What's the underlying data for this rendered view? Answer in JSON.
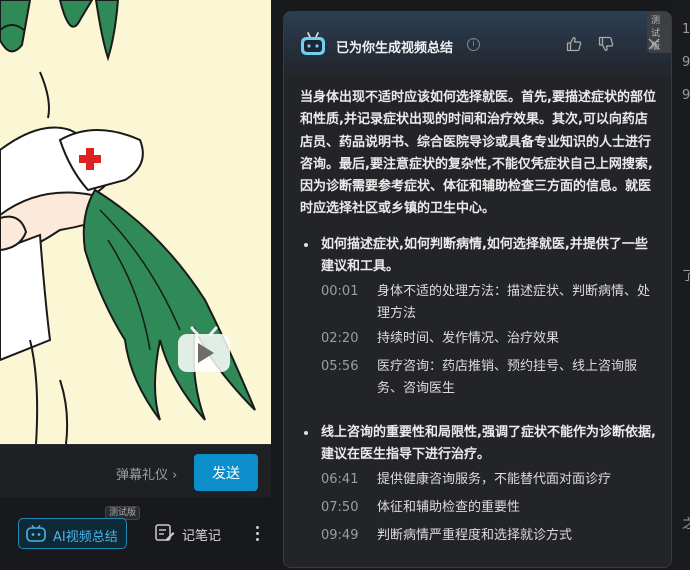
{
  "player": {
    "danmaku_placeholder": "",
    "danmaku_etiquette": "弹幕礼仪 ›",
    "send_label": "发送",
    "ai_summary_label": "AI视频总结",
    "beta_tag": "测试版",
    "notes_label": "记笔记"
  },
  "panel": {
    "beta_tag": "测试版",
    "title": "已为你生成视频总结",
    "summary": "当身体出现不适时应该如何选择就医。首先,要描述症状的部位和性质,并记录症状出现的时间和治疗效果。其次,可以向药店店员、药品说明书、综合医院导诊或具备专业知识的人士进行咨询。最后,要注意症状的复杂性,不能仅凭症状自己上网搜索,因为诊断需要参考症状、体征和辅助检查三方面的信息。就医时应选择社区或乡镇的卫生中心。",
    "sections": [
      {
        "title": "如何描述症状,如何判断病情,如何选择就医,并提供了一些建议和工具。",
        "items": [
          {
            "time": "00:01",
            "text": "身体不适的处理方法：描述症状、判断病情、处理方法"
          },
          {
            "time": "02:20",
            "text": "持续时间、发作情况、治疗效果"
          },
          {
            "time": "05:56",
            "text": "医疗咨询：药店推销、预约挂号、线上咨询服务、咨询医生"
          }
        ]
      },
      {
        "title": "线上咨询的重要性和局限性,强调了症状不能作为诊断依据,建议在医生指导下进行治疗。",
        "items": [
          {
            "time": "06:41",
            "text": "提供健康咨询服务，不能替代面对面诊疗"
          },
          {
            "time": "07:50",
            "text": "体征和辅助检查的重要性"
          },
          {
            "time": "09:49",
            "text": "判断病情严重程度和选择就诊方式"
          }
        ]
      }
    ]
  },
  "background_edge": {
    "chars": [
      "1",
      "9",
      "9",
      "了",
      "之"
    ]
  },
  "colors": {
    "accent": "#0b8ec9",
    "panel_bg": "#232427",
    "video_bg": "#fbf7d4"
  }
}
